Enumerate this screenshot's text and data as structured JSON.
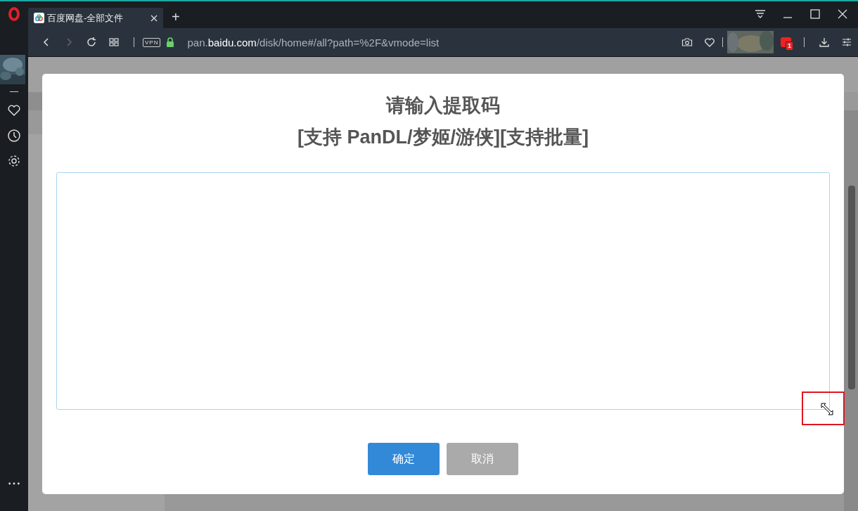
{
  "browser": {
    "tab": {
      "title": "百度网盘-全部文件",
      "selected": true
    },
    "new_tab": "+",
    "vpn": "VPN",
    "url": "pan.**baidu.com**/disk/home#/all?path=%2F&vmode=list",
    "extension_badge": "1"
  },
  "dialog": {
    "title_lines": [
      "请输入提取码",
      "[支持 PanDL/梦姬/游侠][支持批量]"
    ],
    "buttons": [
      {
        "label": "确定",
        "kind": "primary"
      },
      {
        "label": "取消",
        "kind": "secondary"
      }
    ]
  }
}
